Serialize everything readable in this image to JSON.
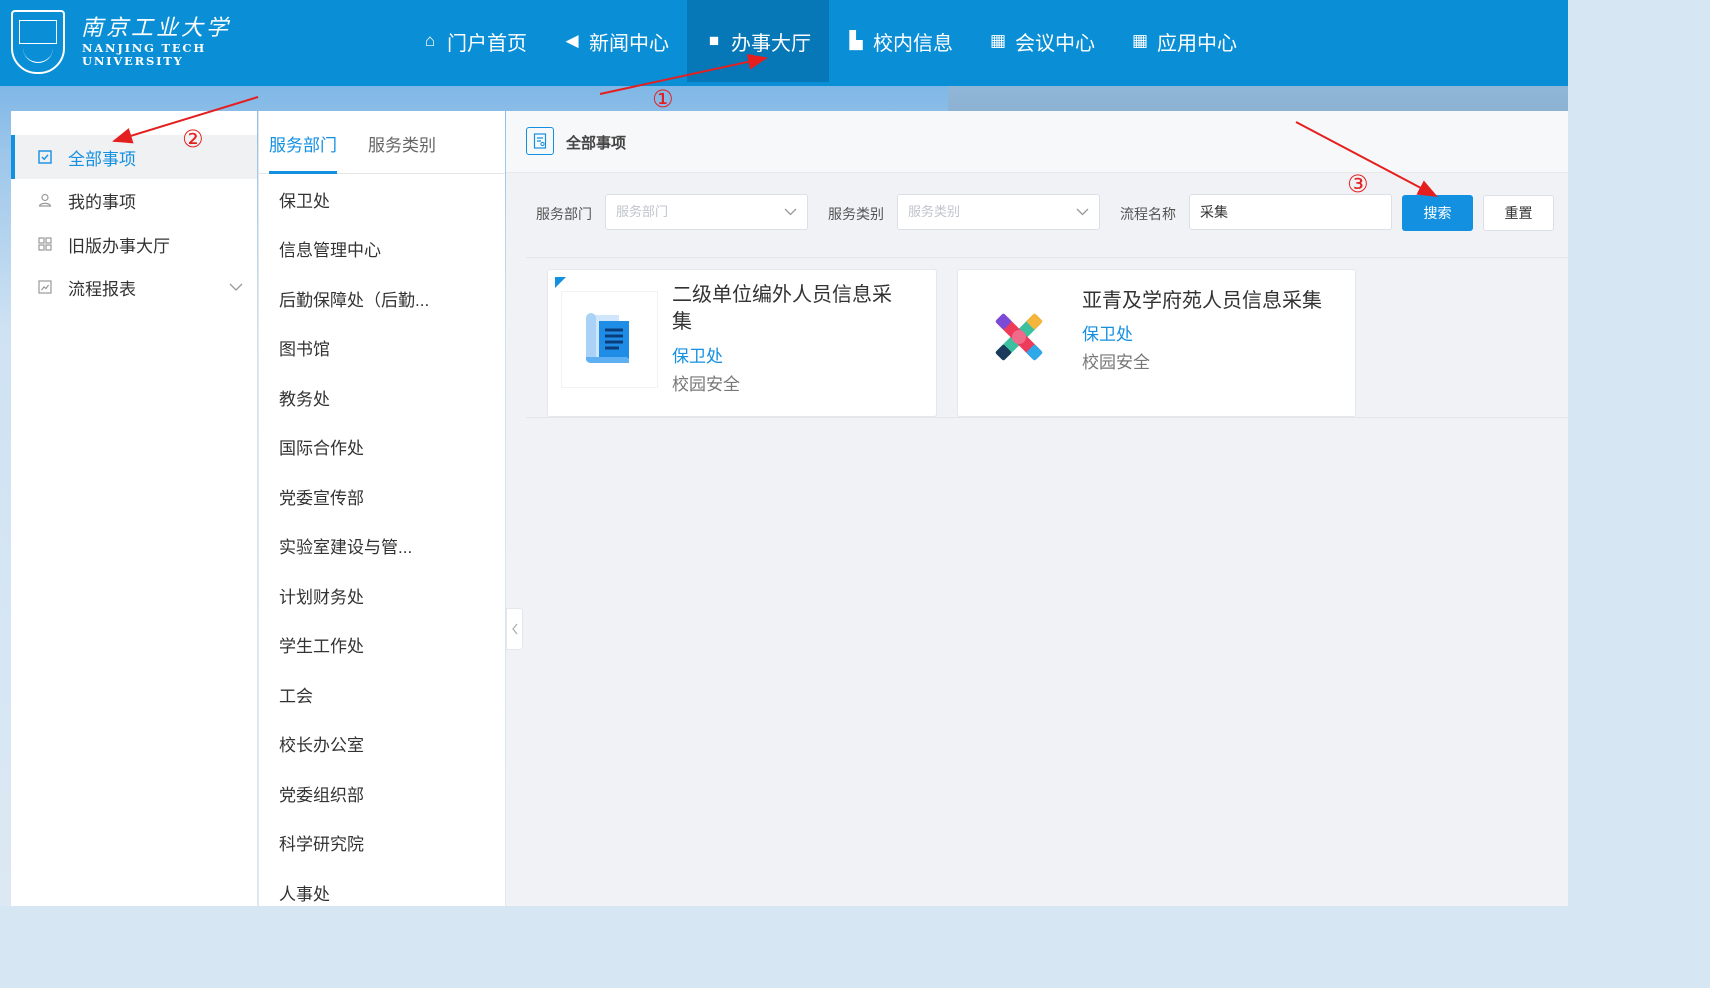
{
  "header": {
    "logo_cn": "南京工业大学",
    "logo_en_line1": "NANJING TECH",
    "logo_en_line2": "UNIVERSITY",
    "nav": [
      {
        "label": "门户首页",
        "icon": "home-icon",
        "glyph": "⌂"
      },
      {
        "label": "新闻中心",
        "icon": "speaker-icon",
        "glyph": "◀"
      },
      {
        "label": "办事大厅",
        "icon": "briefcase-icon",
        "glyph": "■",
        "active": true
      },
      {
        "label": "校内信息",
        "icon": "building-icon",
        "glyph": "▙"
      },
      {
        "label": "会议中心",
        "icon": "table-icon",
        "glyph": "▦"
      },
      {
        "label": "应用中心",
        "icon": "grid-icon",
        "glyph": "▦"
      }
    ]
  },
  "sidebar": {
    "items": [
      {
        "label": "全部事项",
        "icon": "checkbox-icon",
        "active": true
      },
      {
        "label": "我的事项",
        "icon": "user-icon"
      },
      {
        "label": "旧版办事大厅",
        "icon": "apps-icon"
      },
      {
        "label": "流程报表",
        "icon": "chart-icon",
        "expandable": true
      }
    ]
  },
  "dept_panel": {
    "tabs": [
      "服务部门",
      "服务类别"
    ],
    "active_tab": "服务部门",
    "departments": [
      "保卫处",
      "信息管理中心",
      "后勤保障处（后勤...",
      "图书馆",
      "教务处",
      "国际合作处",
      "党委宣传部",
      "实验室建设与管...",
      "计划财务处",
      "学生工作处",
      "工会",
      "校长办公室",
      "党委组织部",
      "科学研究院",
      "人事处"
    ]
  },
  "main": {
    "title": "全部事项",
    "filters": {
      "dept_label": "服务部门",
      "dept_placeholder": "服务部门",
      "category_label": "服务类别",
      "category_placeholder": "服务类别",
      "name_label": "流程名称",
      "name_value": "采集"
    },
    "search_button": "搜索",
    "reset_button": "重置",
    "results": [
      {
        "title_line1": "二级单位编外人员信息采",
        "title_line2": "集",
        "dept": "保卫处",
        "category": "校园安全"
      },
      {
        "title_line1": "亚青及学府苑人员信息采集",
        "title_line2": "",
        "dept": "保卫处",
        "category": "校园安全"
      }
    ]
  },
  "annotations": [
    "①",
    "②",
    "③"
  ],
  "colors": {
    "header": "#0a8fd6",
    "header_active": "#0778b7",
    "accent": "#1390e0",
    "annotation": "#e51f1f"
  }
}
